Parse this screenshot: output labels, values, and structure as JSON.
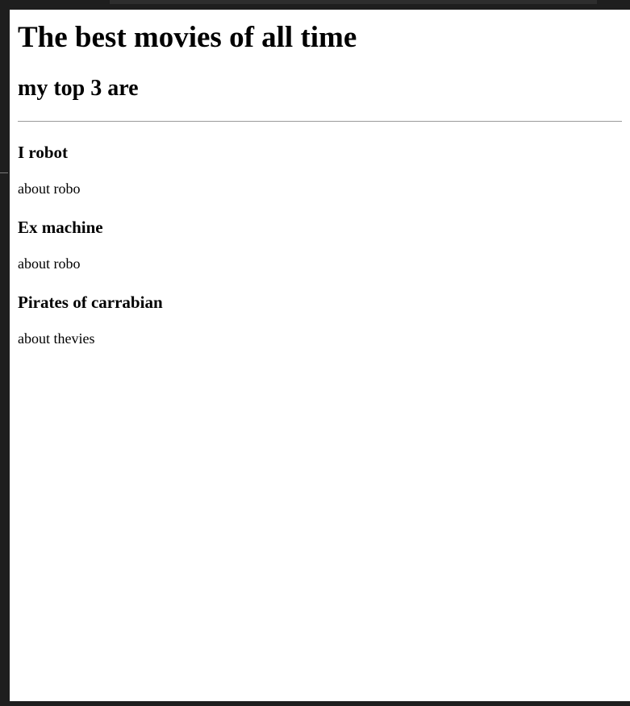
{
  "page": {
    "title": "The best movies of all time",
    "subtitle": "my top 3 are",
    "movies": [
      {
        "name": "I robot",
        "description": "about robo"
      },
      {
        "name": "Ex machine",
        "description": "about robo"
      },
      {
        "name": "Pirates of carrabian",
        "description": "about thevies"
      }
    ]
  },
  "colors": {
    "editor_background": "#1e1e1e",
    "preview_background": "#ffffff",
    "text": "#000000",
    "divider": "#9a9a9a"
  }
}
